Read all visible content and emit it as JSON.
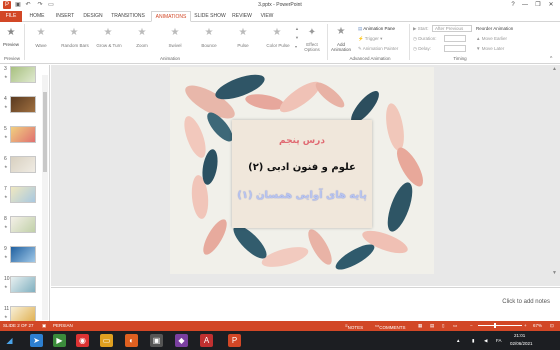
{
  "window": {
    "title": "3.pptx - PowerPoint",
    "minimize": "—",
    "restore": "❐",
    "close": "✕",
    "help": "?"
  },
  "tabs": [
    "FILE",
    "HOME",
    "INSERT",
    "DESIGN",
    "TRANSITIONS",
    "ANIMATIONS",
    "SLIDE SHOW",
    "REVIEW",
    "VIEW"
  ],
  "ribbon": {
    "preview_label": "Preview",
    "effects": [
      "Wave",
      "Random Bars",
      "Grow & Turn",
      "Zoom",
      "Swivel",
      "Bounce",
      "Pulse",
      "Color Pulse"
    ],
    "effect_options": "Effect Options",
    "add_animation": "Add Animation",
    "animation_pane": "Animation Pane",
    "trigger": "Trigger",
    "animation_painter": "Animation Painter",
    "start_label": "Start:",
    "start_value": "After Previous",
    "duration_label": "Duration:",
    "delay_label": "Delay:",
    "reorder_title": "Reorder Animation",
    "move_earlier": "Move Earlier",
    "move_later": "Move Later",
    "groups": {
      "preview": "Preview",
      "animation": "Animation",
      "advanced": "Advanced Animation",
      "timing": "Timing"
    }
  },
  "thumbnails": [
    {
      "num": "3",
      "star": "★",
      "colors": [
        "#a8c080",
        "#e0ead0"
      ]
    },
    {
      "num": "4",
      "star": "★",
      "colors": [
        "#5a3a20",
        "#a07040"
      ]
    },
    {
      "num": "5",
      "star": "★",
      "colors": [
        "#f0d080",
        "#e07070"
      ]
    },
    {
      "num": "6",
      "star": "★",
      "colors": [
        "#d8d0c0",
        "#f0ece4"
      ]
    },
    {
      "num": "7",
      "star": "★",
      "colors": [
        "#f0e8c0",
        "#a8c8e0"
      ]
    },
    {
      "num": "8",
      "star": "★",
      "colors": [
        "#f4f0e8",
        "#c0d0a8"
      ]
    },
    {
      "num": "9",
      "star": "★",
      "colors": [
        "#2060a0",
        "#a0c8e8"
      ]
    },
    {
      "num": "10",
      "star": "★",
      "colors": [
        "#e8f0f0",
        "#80b0c0"
      ]
    },
    {
      "num": "11",
      "star": "★",
      "colors": [
        "#f8f0d8",
        "#e0b050"
      ]
    }
  ],
  "slide": {
    "line1": "درس پنجم",
    "line2": "علوم و فنون ادبی (۲)",
    "line3": "پایه های آوایی همسان (۱)"
  },
  "notes_placeholder": "Click to add notes",
  "status": {
    "slide_of": "SLIDE 2 OF 27",
    "language": "PERSIAN",
    "notes": "NOTES",
    "comments": "COMMENTS",
    "zoom": "67%"
  },
  "taskbar": {
    "time": "21:01",
    "date": "02/06/2021",
    "lang": "FA"
  },
  "colors": {
    "accent": "#d24726",
    "taskbar": "#1c1e22"
  }
}
